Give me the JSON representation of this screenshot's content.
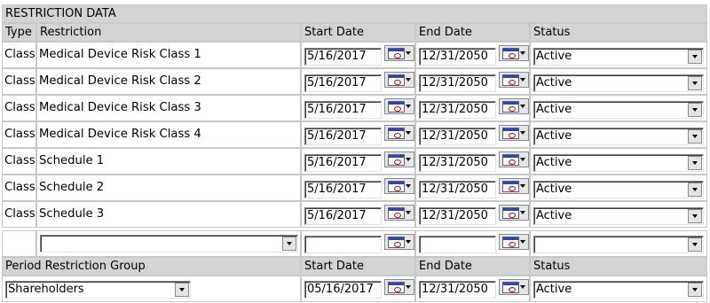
{
  "section_title": "RESTRICTION DATA",
  "headers": {
    "type": "Type",
    "restriction": "Restriction",
    "start_date": "Start Date",
    "end_date": "End Date",
    "status": "Status"
  },
  "rows": [
    {
      "type": "Class",
      "restriction": "Medical Device Risk Class 1",
      "start": "5/16/2017",
      "end": "12/31/2050",
      "status": "Active"
    },
    {
      "type": "Class",
      "restriction": "Medical Device Risk Class 2",
      "start": "5/16/2017",
      "end": "12/31/2050",
      "status": "Active"
    },
    {
      "type": "Class",
      "restriction": "Medical Device Risk Class 3",
      "start": "5/16/2017",
      "end": "12/31/2050",
      "status": "Active"
    },
    {
      "type": "Class",
      "restriction": "Medical Device Risk Class 4",
      "start": "5/16/2017",
      "end": "12/31/2050",
      "status": "Active"
    },
    {
      "type": "Class",
      "restriction": "Schedule 1",
      "start": "5/16/2017",
      "end": "12/31/2050",
      "status": "Active"
    },
    {
      "type": "Class",
      "restriction": "Schedule 2",
      "start": "5/16/2017",
      "end": "12/31/2050",
      "status": "Active"
    },
    {
      "type": "Class",
      "restriction": "Schedule 3",
      "start": "5/16/2017",
      "end": "12/31/2050",
      "status": "Active"
    }
  ],
  "new_row": {
    "restriction": "",
    "start": "",
    "end": "",
    "status": ""
  },
  "period": {
    "header": "Period Restriction Group",
    "start_header": "Start Date",
    "end_header": "End Date",
    "status_header": "Status",
    "group": "Shareholders",
    "start": "05/16/2017",
    "end": "12/31/2050",
    "status": "Active"
  },
  "icons": {
    "calendar": "calendar-icon",
    "dropdown": "chevron-down-icon"
  }
}
